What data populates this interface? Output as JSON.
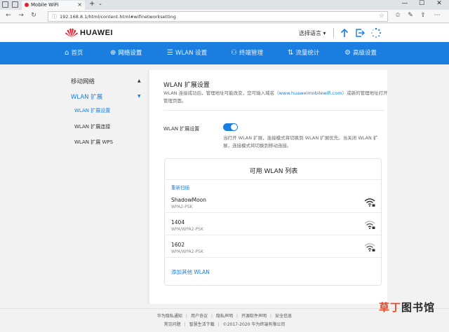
{
  "browser": {
    "tab_title": "Mobile WiFi",
    "address": "192.168.8.1/html/content.html#wifinetworksetting",
    "new_tab": "+",
    "tab_close": "×"
  },
  "header": {
    "brand": "HUAWEI",
    "language": "选择语言 ▾"
  },
  "menu": {
    "items": [
      {
        "label": "首页",
        "icon": "home-icon"
      },
      {
        "label": "网络设置",
        "icon": "globe-icon"
      },
      {
        "label": "WLAN 设置",
        "icon": "wifi-icon"
      },
      {
        "label": "终端管理",
        "icon": "devices-icon"
      },
      {
        "label": "流量统计",
        "icon": "traffic-icon"
      },
      {
        "label": "高级设置",
        "icon": "gear-icon"
      }
    ],
    "active": "网络设置"
  },
  "sidebar": {
    "items": [
      {
        "label": "移动网络"
      },
      {
        "label": "WLAN 扩展"
      },
      {
        "label": "WLAN 扩展设置"
      },
      {
        "label": "WLAN 扩展连接"
      },
      {
        "label": "WLAN 扩展 WPS"
      }
    ]
  },
  "main": {
    "title": "WLAN 扩展设置",
    "desc_pre": "WLAN 连接成功后，管理地址可能改变，您可输入域名（",
    "desc_link": "www.huaweimobilewifi.com",
    "desc_post": "）或新的管理地址打开管理页面。",
    "setting_label": "WLAN 扩展设置",
    "setting_desc": "当打开 WLAN 扩展，连接模式将切换到 WLAN 扩展优先。当关闭 WLAN 扩展，连接模式将切换到移动连接。",
    "toggle_on": true
  },
  "wlan_list": {
    "title": "可用 WLAN 列表",
    "rescan": "重新扫描",
    "networks": [
      {
        "name": "ShadowMoon",
        "security": "WPA2-PSK"
      },
      {
        "name": "1404",
        "security": "WPA/WPA2-PSK"
      },
      {
        "name": "1602",
        "security": "WPA/WPA2-PSK"
      }
    ],
    "add": "添加其他 WLAN"
  },
  "footer": {
    "row1": [
      "华为隐私通知",
      "用户协议",
      "隐私声明",
      "开源软件声明",
      "安全信息"
    ],
    "row2": [
      "常见问题",
      "智慧生活下载",
      "©2017-2020 华为终端有限公司"
    ]
  },
  "watermark": {
    "part1": "草丁",
    "part2": "图书馆"
  },
  "colors": {
    "accent": "#1a7ee0",
    "brand_red": "#e1212d"
  }
}
